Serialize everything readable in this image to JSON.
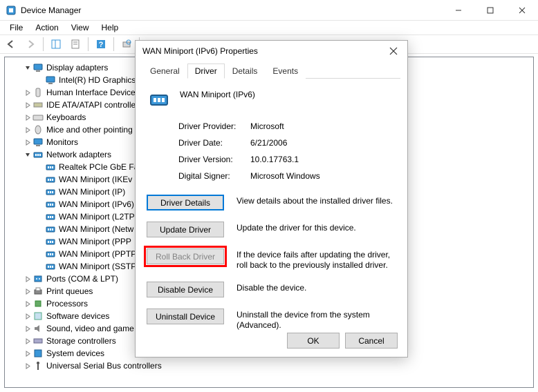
{
  "window": {
    "title": "Device Manager",
    "menus": [
      "File",
      "Action",
      "View",
      "Help"
    ]
  },
  "tree": {
    "items": [
      {
        "indent": 1,
        "expander": "open",
        "icon": "display",
        "label": "Display adapters"
      },
      {
        "indent": 2,
        "expander": "none",
        "icon": "display",
        "label": "Intel(R) HD Graphics"
      },
      {
        "indent": 1,
        "expander": "closed",
        "icon": "hid",
        "label": "Human Interface Device"
      },
      {
        "indent": 1,
        "expander": "closed",
        "icon": "ide",
        "label": "IDE ATA/ATAPI controlle"
      },
      {
        "indent": 1,
        "expander": "closed",
        "icon": "keyboard",
        "label": "Keyboards"
      },
      {
        "indent": 1,
        "expander": "closed",
        "icon": "mouse",
        "label": "Mice and other pointing"
      },
      {
        "indent": 1,
        "expander": "closed",
        "icon": "display",
        "label": "Monitors"
      },
      {
        "indent": 1,
        "expander": "open",
        "icon": "net",
        "label": "Network adapters"
      },
      {
        "indent": 2,
        "expander": "none",
        "icon": "net",
        "label": "Realtek PCIe GbE Fam"
      },
      {
        "indent": 2,
        "expander": "none",
        "icon": "net",
        "label": "WAN Miniport (IKEv"
      },
      {
        "indent": 2,
        "expander": "none",
        "icon": "net",
        "label": "WAN Miniport (IP)"
      },
      {
        "indent": 2,
        "expander": "none",
        "icon": "net",
        "label": "WAN Miniport (IPv6)"
      },
      {
        "indent": 2,
        "expander": "none",
        "icon": "net",
        "label": "WAN Miniport (L2TP"
      },
      {
        "indent": 2,
        "expander": "none",
        "icon": "net",
        "label": "WAN Miniport (Netw"
      },
      {
        "indent": 2,
        "expander": "none",
        "icon": "net",
        "label": "WAN Miniport (PPP"
      },
      {
        "indent": 2,
        "expander": "none",
        "icon": "net",
        "label": "WAN Miniport (PPTP"
      },
      {
        "indent": 2,
        "expander": "none",
        "icon": "net",
        "label": "WAN Miniport (SSTP"
      },
      {
        "indent": 1,
        "expander": "closed",
        "icon": "port",
        "label": "Ports (COM & LPT)"
      },
      {
        "indent": 1,
        "expander": "closed",
        "icon": "printer",
        "label": "Print queues"
      },
      {
        "indent": 1,
        "expander": "closed",
        "icon": "cpu",
        "label": "Processors"
      },
      {
        "indent": 1,
        "expander": "closed",
        "icon": "soft",
        "label": "Software devices"
      },
      {
        "indent": 1,
        "expander": "closed",
        "icon": "sound",
        "label": "Sound, video and game"
      },
      {
        "indent": 1,
        "expander": "closed",
        "icon": "storage",
        "label": "Storage controllers"
      },
      {
        "indent": 1,
        "expander": "closed",
        "icon": "system",
        "label": "System devices"
      },
      {
        "indent": 1,
        "expander": "closed",
        "icon": "usb",
        "label": "Universal Serial Bus controllers"
      }
    ]
  },
  "dialog": {
    "title": "WAN Miniport (IPv6) Properties",
    "tabs": [
      "General",
      "Driver",
      "Details",
      "Events"
    ],
    "active_tab": "Driver",
    "device_name": "WAN Miniport (IPv6)",
    "info": {
      "provider_label": "Driver Provider:",
      "provider_value": "Microsoft",
      "date_label": "Driver Date:",
      "date_value": "6/21/2006",
      "version_label": "Driver Version:",
      "version_value": "10.0.17763.1",
      "signer_label": "Digital Signer:",
      "signer_value": "Microsoft Windows"
    },
    "buttons": {
      "details": {
        "label": "Driver Details",
        "desc": "View details about the installed driver files."
      },
      "update": {
        "label": "Update Driver",
        "desc": "Update the driver for this device."
      },
      "rollback": {
        "label": "Roll Back Driver",
        "desc": "If the device fails after updating the driver, roll back to the previously installed driver."
      },
      "disable": {
        "label": "Disable Device",
        "desc": "Disable the device."
      },
      "uninstall": {
        "label": "Uninstall Device",
        "desc": "Uninstall the device from the system (Advanced)."
      }
    },
    "ok": "OK",
    "cancel": "Cancel"
  }
}
